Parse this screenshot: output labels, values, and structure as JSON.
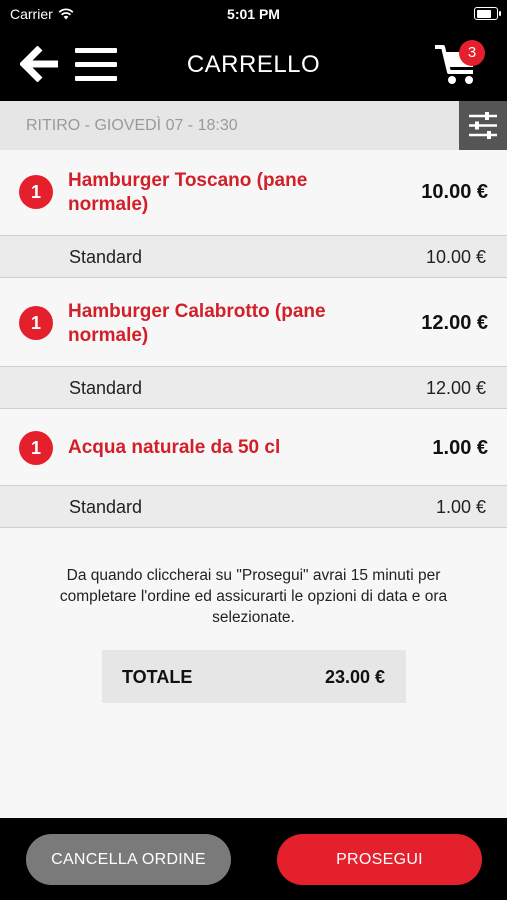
{
  "status_bar": {
    "carrier": "Carrier",
    "time": "5:01 PM"
  },
  "nav": {
    "title": "CARRELLO",
    "cart_count": "3"
  },
  "pickup": {
    "label": "RITIRO - GIOVEDÌ 07 - 18:30"
  },
  "items": [
    {
      "qty": "1",
      "name": "Hamburger Toscano (pane normale)",
      "price": "10.00 €",
      "variant": {
        "label": "Standard",
        "price": "10.00 €"
      }
    },
    {
      "qty": "1",
      "name": "Hamburger Calabrotto (pane normale)",
      "price": "12.00 €",
      "variant": {
        "label": "Standard",
        "price": "12.00 €"
      }
    },
    {
      "qty": "1",
      "name": "Acqua naturale da 50 cl",
      "price": "1.00 €",
      "variant": {
        "label": "Standard",
        "price": "1.00 €"
      }
    }
  ],
  "notice": "Da quando cliccherai su \"Prosegui\" avrai 15 minuti per completare l'ordine ed assicurarti le opzioni di data e ora selezionate.",
  "total": {
    "label": "TOTALE",
    "value": "23.00 €"
  },
  "footer": {
    "cancel_label": "CANCELLA ORDINE",
    "proceed_label": "PROSEGUI"
  },
  "colors": {
    "accent": "#e3202b",
    "header": "#000000",
    "cancel": "#7a7a7a"
  }
}
